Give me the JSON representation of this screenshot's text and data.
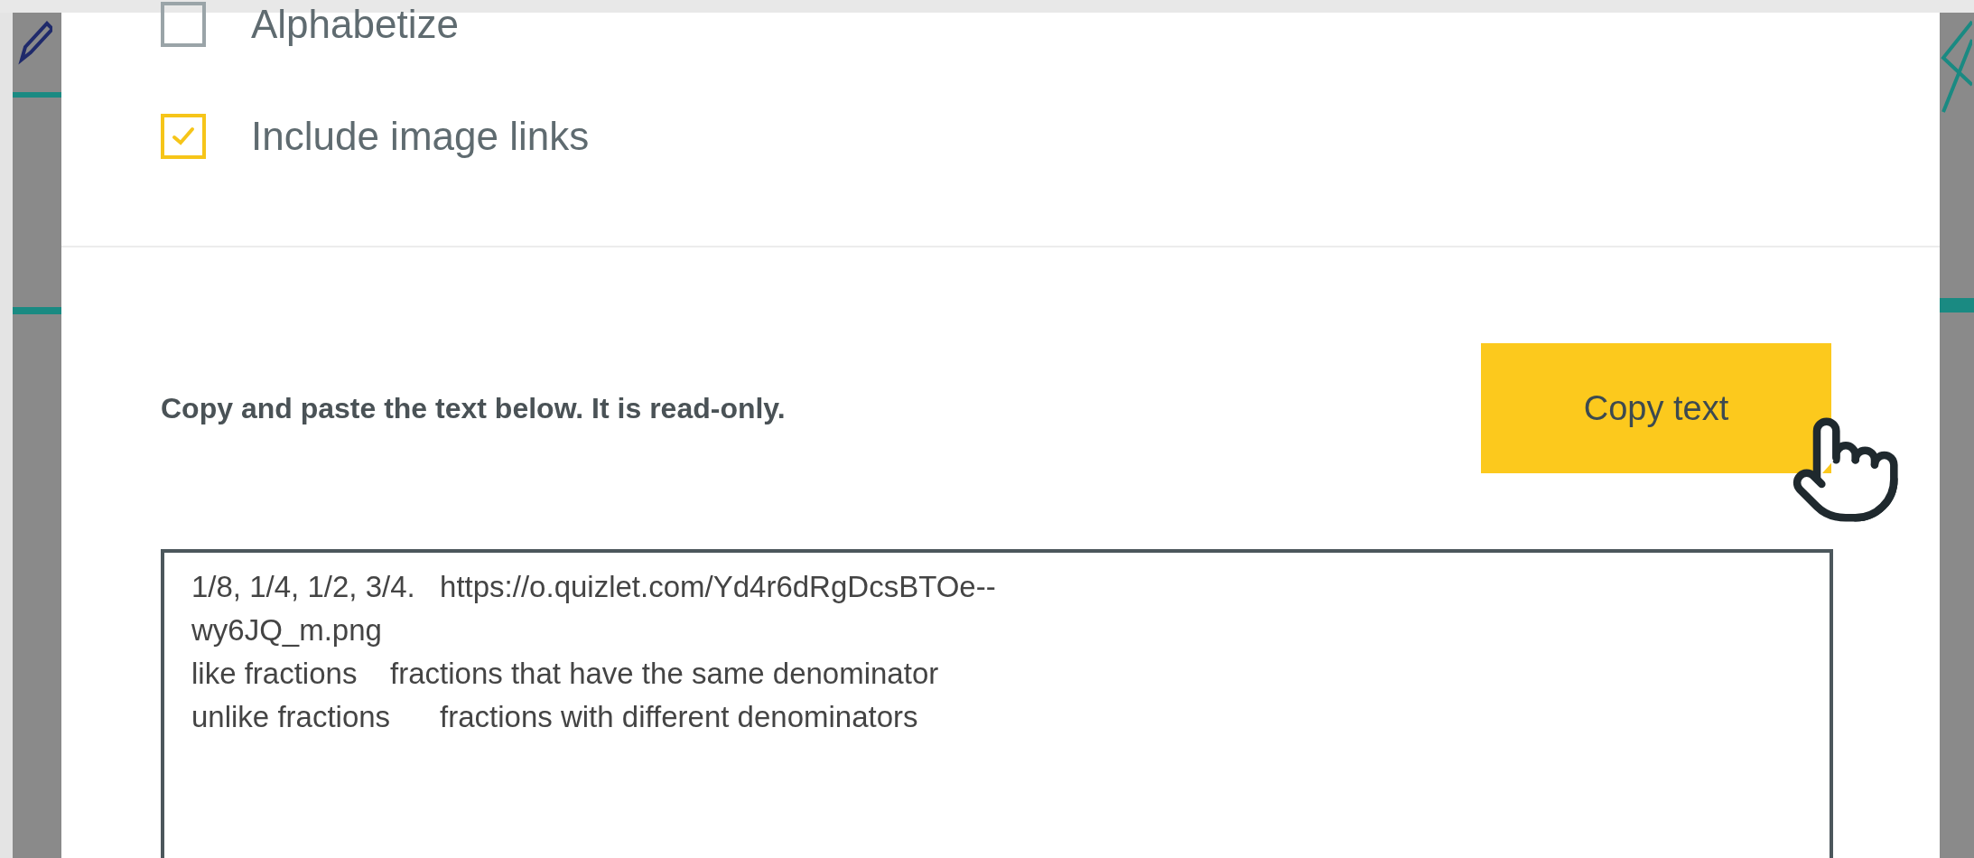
{
  "options": [
    {
      "label": "Alphabetize",
      "checked": false
    },
    {
      "label": "Include image links",
      "checked": true
    }
  ],
  "instructions": "Copy and paste the text below. It is read-only.",
  "copy_button": "Copy text",
  "export_text": [
    "1/8, 1/4, 1/2, 3/4.\thttps://o.quizlet.com/Yd4r6dRgDcsBTOe--",
    "wy6JQ_m.png",
    "like fractions\tfractions that have the same denominator",
    "unlike fractions\tfractions with different denominators"
  ]
}
